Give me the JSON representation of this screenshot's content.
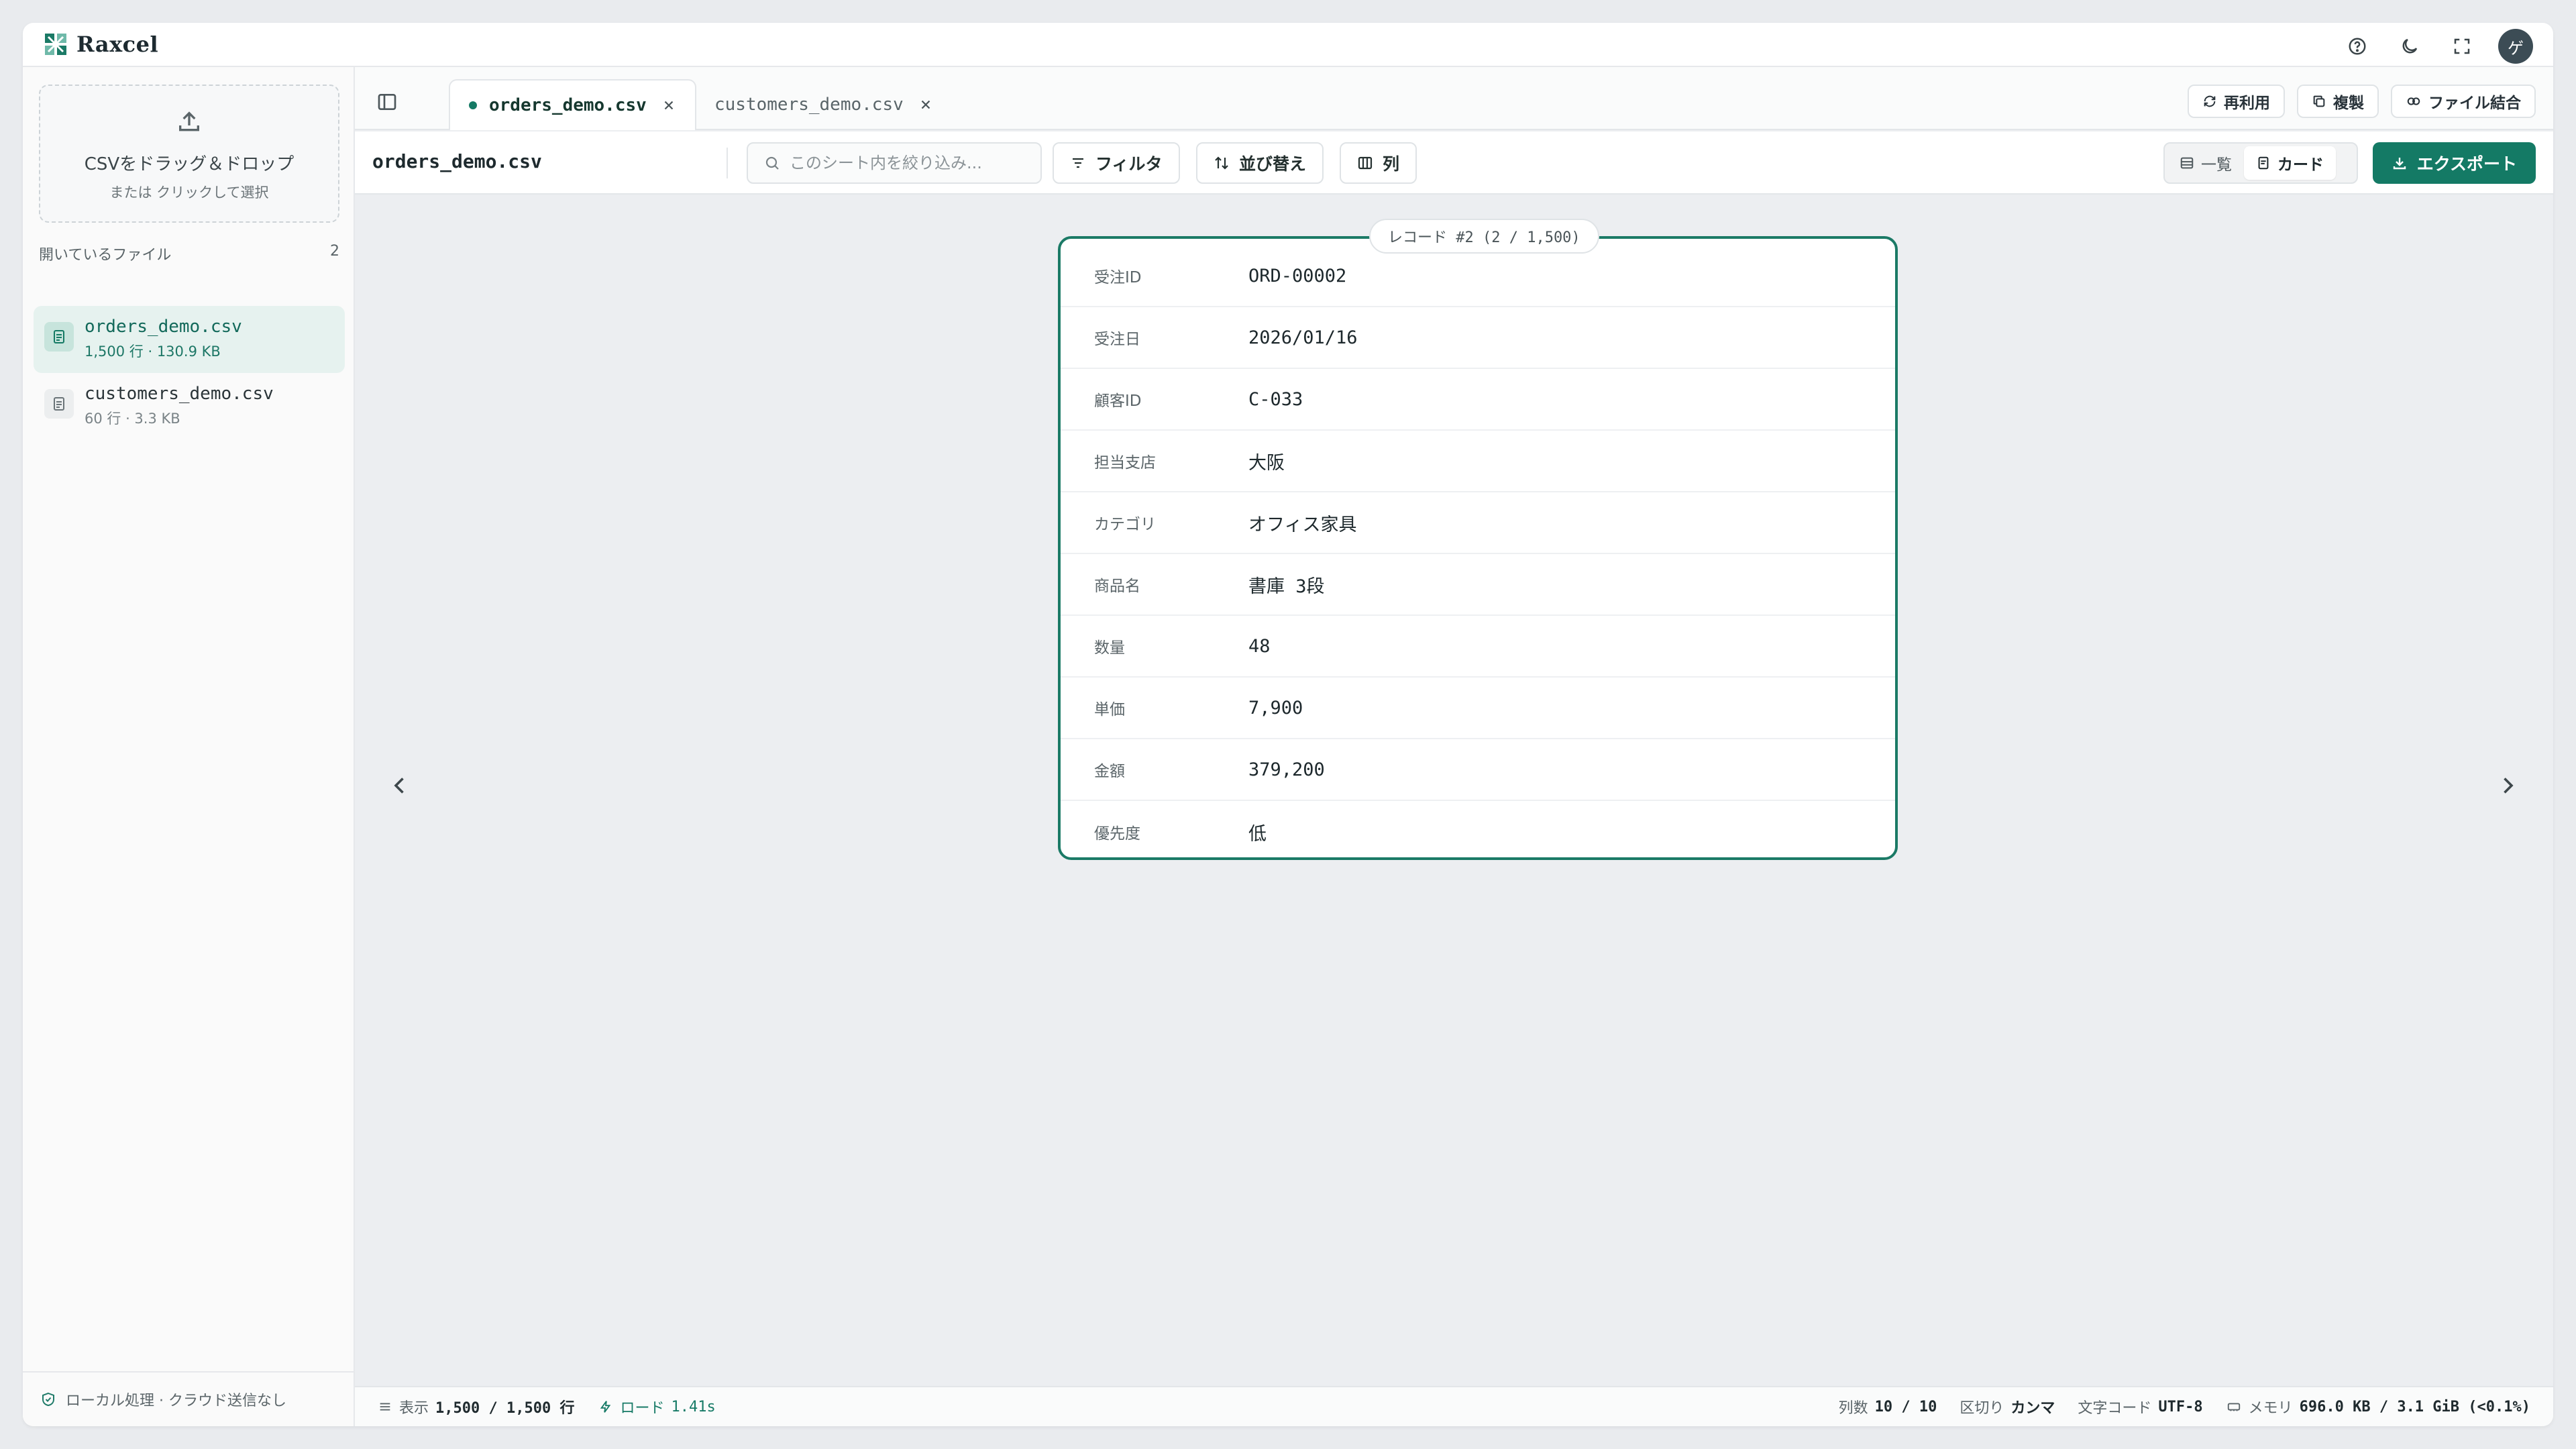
{
  "app": {
    "name": "Raxcel",
    "avatar_initial": "ゲ"
  },
  "top_icons": [
    "help-icon",
    "moon-icon",
    "fullscreen-icon"
  ],
  "sidebar": {
    "dropzone_title": "CSVをドラッグ＆ドロップ",
    "dropzone_sub": "または クリックして選択",
    "files_label": "開いているファイル",
    "files_count": "2",
    "files": [
      {
        "name": "orders_demo.csv",
        "meta": "1,500 行 · 130.9 KB",
        "active": true
      },
      {
        "name": "customers_demo.csv",
        "meta": "60 行 · 3.3 KB",
        "active": false
      }
    ],
    "footer": "ローカル処理 · クラウド送信なし"
  },
  "tabs": [
    {
      "label": "orders_demo.csv",
      "active": true
    },
    {
      "label": "customers_demo.csv",
      "active": false
    }
  ],
  "tab_actions": {
    "reuse": "再利用",
    "duplicate": "複製",
    "merge": "ファイル結合"
  },
  "toolbar": {
    "sheet_name": "orders_demo.csv",
    "search_placeholder": "このシート内を絞り込み...",
    "filter": "フィルタ",
    "sort": "並び替え",
    "columns": "列",
    "view_list": "一覧",
    "view_card": "カード",
    "export": "エクスポート"
  },
  "card": {
    "badge": "レコード #2 (2 / 1,500)",
    "fields": [
      {
        "label": "受注ID",
        "value": "ORD-00002"
      },
      {
        "label": "受注日",
        "value": "2026/01/16"
      },
      {
        "label": "顧客ID",
        "value": "C-033"
      },
      {
        "label": "担当支店",
        "value": "大阪"
      },
      {
        "label": "カテゴリ",
        "value": "オフィス家具"
      },
      {
        "label": "商品名",
        "value": "書庫 3段"
      },
      {
        "label": "数量",
        "value": "48"
      },
      {
        "label": "単価",
        "value": "7,900"
      },
      {
        "label": "金額",
        "value": "379,200"
      },
      {
        "label": "優先度",
        "value": "低"
      }
    ]
  },
  "status": {
    "display_label": "表示",
    "display_value": "1,500 / 1,500 行",
    "load_label": "ロード",
    "load_value": "1.41s",
    "cols_label": "列数",
    "cols_value": "10 / 10",
    "delim_label": "区切り",
    "delim_value": "カンマ",
    "encoding_label": "文字コード",
    "encoding_value": "UTF-8",
    "memory_label": "メモリ",
    "memory_value": "696.0 KB / 3.1 GiB (<0.1%)"
  },
  "colors": {
    "accent": "#147a65",
    "accent_light": "#e6f2ef"
  }
}
